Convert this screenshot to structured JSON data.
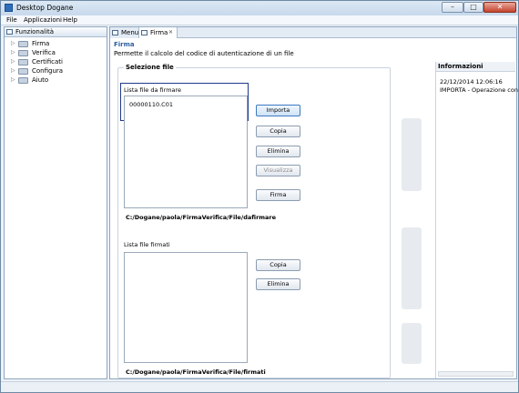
{
  "window": {
    "title": "Desktop Dogane"
  },
  "menubar": [
    "File",
    "Applicazioni",
    "Help"
  ],
  "sidebar": {
    "tab_label": "Funzionalità",
    "items": [
      {
        "label": "Firma"
      },
      {
        "label": "Verifica"
      },
      {
        "label": "Certificati"
      },
      {
        "label": "Configura"
      },
      {
        "label": "Aiuto"
      }
    ]
  },
  "tabs": [
    {
      "label": "Menu"
    },
    {
      "label": "Firma"
    }
  ],
  "form": {
    "title": "Firma",
    "description": "Permette il calcolo del codice di autenticazione di un file",
    "group_title": "Selezione file",
    "to_sign": {
      "label": "Lista file da firmare",
      "items": [
        "00000110.C01"
      ],
      "path": "C:/Dogane/paola/FirmaVerifica/File/dafirmare",
      "buttons": {
        "importa": "Importa",
        "copia": "Copia",
        "elimina": "Elimina",
        "visualizza": "Visualizza",
        "firma": "Firma"
      }
    },
    "signed": {
      "label": "Lista file firmati",
      "path": "C:/Dogane/paola/FirmaVerifica/File/firmati",
      "buttons": {
        "copia": "Copia",
        "elimina": "Elimina"
      }
    }
  },
  "info": {
    "title": "Informazioni",
    "lines": [
      "22/12/2014 12:06:16",
      "IMPORTA - Operazione con"
    ]
  },
  "colors": {
    "accent": "#2c5f9e",
    "focus_frame": "#1e3a8c"
  }
}
